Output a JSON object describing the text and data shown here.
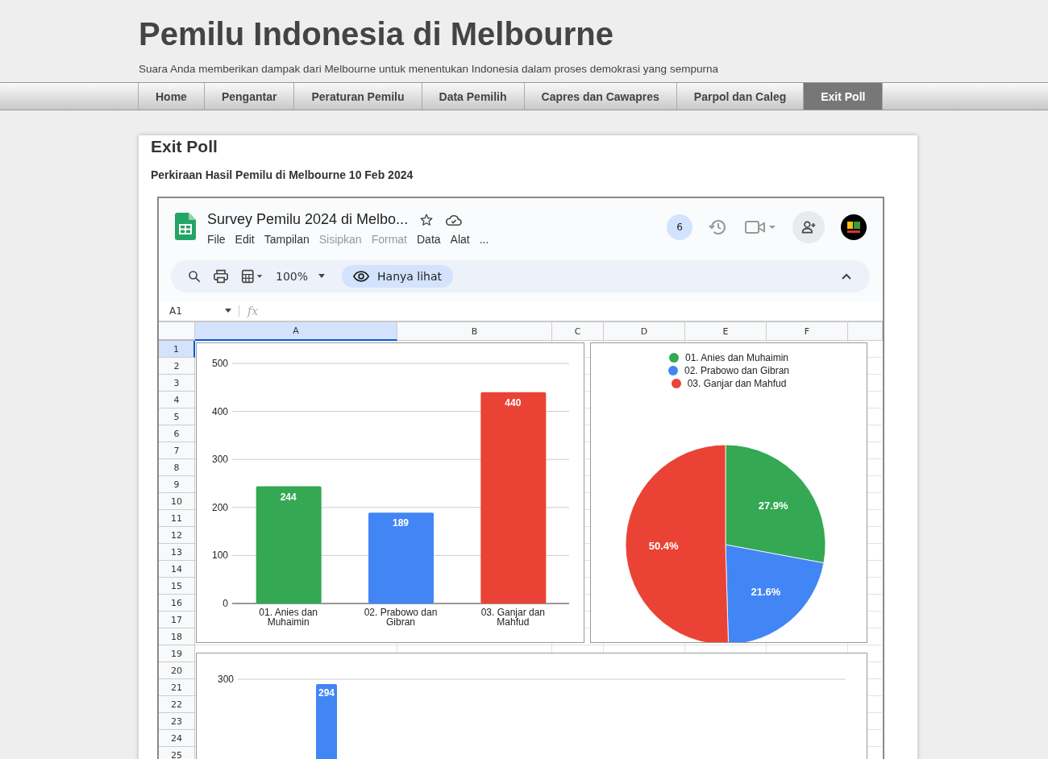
{
  "site": {
    "title": "Pemilu Indonesia di Melbourne",
    "tagline": "Suara Anda memberikan dampak dari Melbourne untuk menentukan Indonesia dalam proses demokrasi yang sempurna"
  },
  "nav": [
    {
      "label": "Home",
      "selected": false
    },
    {
      "label": "Pengantar",
      "selected": false
    },
    {
      "label": "Peraturan Pemilu",
      "selected": false
    },
    {
      "label": "Data Pemilih",
      "selected": false
    },
    {
      "label": "Capres dan Cawapres",
      "selected": false
    },
    {
      "label": "Parpol dan Caleg",
      "selected": false
    },
    {
      "label": "Exit Poll",
      "selected": true
    }
  ],
  "post": {
    "title": "Exit Poll",
    "subtitle": "Perkiraan Hasil Pemilu di Melbourne 10 Feb 2024"
  },
  "sheet": {
    "doc_title": "Survey Pemilu 2024 di Melbo...",
    "menu": [
      {
        "label": "File",
        "disabled": false
      },
      {
        "label": "Edit",
        "disabled": false
      },
      {
        "label": "Tampilan",
        "disabled": false
      },
      {
        "label": "Sisipkan",
        "disabled": true
      },
      {
        "label": "Format",
        "disabled": true
      },
      {
        "label": "Data",
        "disabled": false
      },
      {
        "label": "Alat",
        "disabled": false
      },
      {
        "label": "...",
        "disabled": false
      }
    ],
    "viewer_count": "6",
    "zoom": "100%",
    "view_mode": "Hanya lihat",
    "name_box": "A1",
    "formula_label": "fx",
    "columns": [
      {
        "label": "A",
        "selected": true
      },
      {
        "label": "B",
        "selected": false
      },
      {
        "label": "C",
        "selected": false
      },
      {
        "label": "D",
        "selected": false
      },
      {
        "label": "E",
        "selected": false
      },
      {
        "label": "F",
        "selected": false
      }
    ],
    "rows": [
      {
        "label": "1",
        "selected": true
      },
      {
        "label": "2",
        "selected": false
      },
      {
        "label": "3",
        "selected": false
      },
      {
        "label": "4",
        "selected": false
      },
      {
        "label": "5",
        "selected": false
      },
      {
        "label": "6",
        "selected": false
      },
      {
        "label": "7",
        "selected": false
      },
      {
        "label": "8",
        "selected": false
      },
      {
        "label": "9",
        "selected": false
      },
      {
        "label": "10",
        "selected": false
      },
      {
        "label": "11",
        "selected": false
      },
      {
        "label": "12",
        "selected": false
      },
      {
        "label": "13",
        "selected": false
      },
      {
        "label": "14",
        "selected": false
      },
      {
        "label": "15",
        "selected": false
      },
      {
        "label": "16",
        "selected": false
      },
      {
        "label": "17",
        "selected": false
      },
      {
        "label": "18",
        "selected": false
      },
      {
        "label": "19",
        "selected": false
      },
      {
        "label": "20",
        "selected": false
      },
      {
        "label": "21",
        "selected": false
      },
      {
        "label": "22",
        "selected": false
      },
      {
        "label": "23",
        "selected": false
      },
      {
        "label": "24",
        "selected": false
      },
      {
        "label": "25",
        "selected": false
      }
    ],
    "charts": [
      {
        "chart_data": {
          "type": "bar",
          "categories": [
            "01. Anies dan Muhaimin",
            "02. Prabowo dan Gibran",
            "03. Ganjar dan Mahfud"
          ],
          "values": [
            244,
            189,
            440
          ],
          "colors": [
            "#34a853",
            "#4285f4",
            "#ea4335"
          ],
          "ylim": [
            0,
            500
          ],
          "yticks": [
            0,
            100,
            200,
            300,
            400,
            500
          ],
          "grid": true,
          "data_labels": true
        }
      },
      {
        "chart_data": {
          "type": "pie",
          "categories": [
            "01. Anies dan Muhaimin",
            "02. Prabowo dan Gibran",
            "03. Ganjar dan Mahfud"
          ],
          "values": [
            27.9,
            21.6,
            50.4
          ],
          "colors": [
            "#34a853",
            "#4285f4",
            "#ea4335"
          ],
          "value_labels": [
            "27.9%",
            "21.6%",
            "50.4%"
          ],
          "legend": "top"
        }
      },
      {
        "kind": "partial_bar_chart",
        "gridline_label": "300",
        "bar_label": "294"
      }
    ]
  }
}
